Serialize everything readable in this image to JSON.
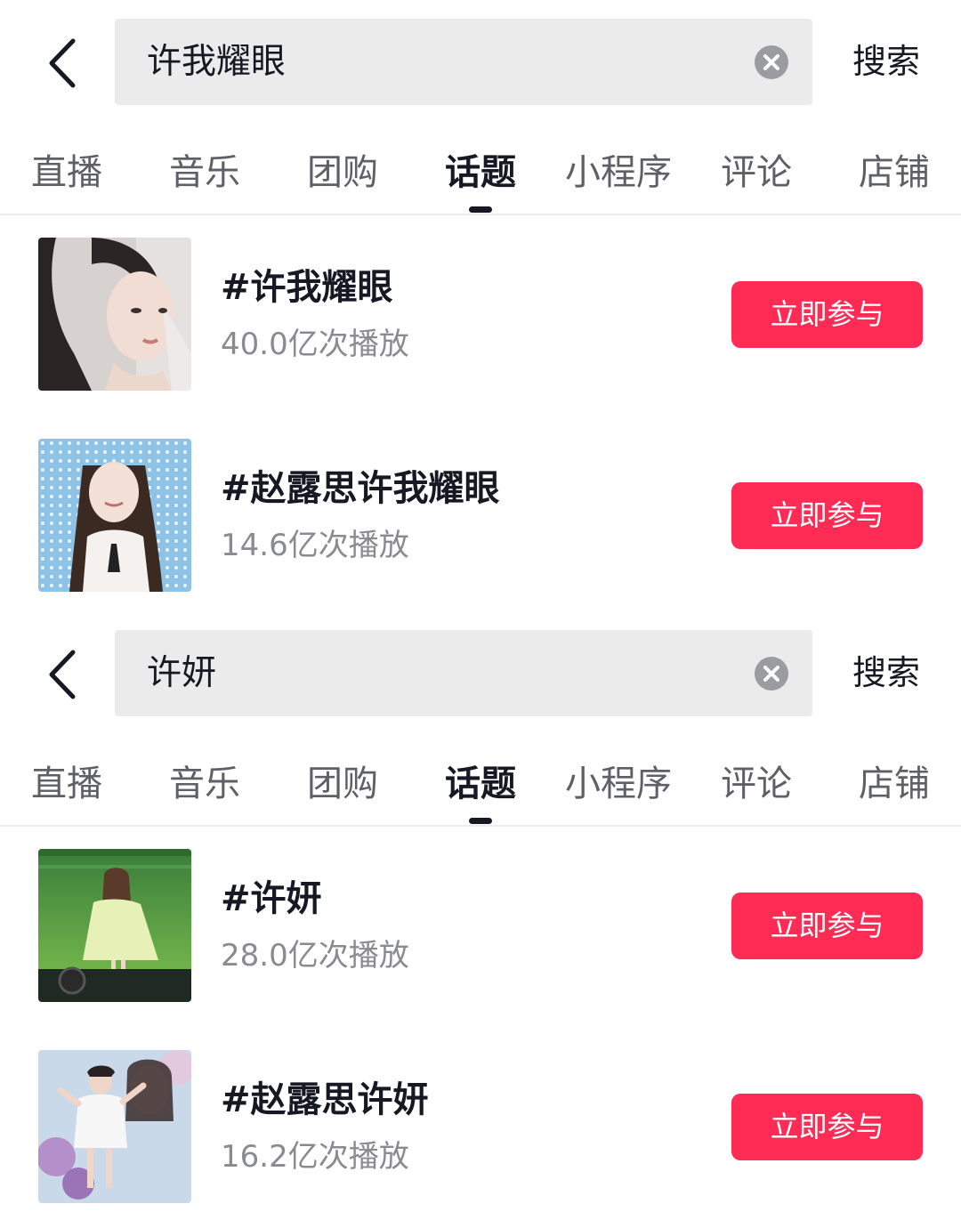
{
  "screens": [
    {
      "query": "许我耀眼",
      "search_label": "搜索",
      "tabs": [
        "直播",
        "音乐",
        "团购",
        "话题",
        "小程序",
        "评论",
        "店铺"
      ],
      "active_tab": "话题",
      "topics": [
        {
          "title": "#许我耀眼",
          "stats": "40.0亿次播放",
          "button": "立即参与",
          "thumb": "portrait-hands-in-hair"
        },
        {
          "title": "#赵露思许我耀眼",
          "stats": "14.6亿次播放",
          "button": "立即参与",
          "thumb": "portrait-stage-lights"
        }
      ]
    },
    {
      "query": "许妍",
      "search_label": "搜索",
      "tabs": [
        "直播",
        "音乐",
        "团购",
        "话题",
        "小程序",
        "评论",
        "店铺"
      ],
      "active_tab": "话题",
      "topics": [
        {
          "title": "#许妍",
          "stats": "28.0亿次播放",
          "button": "立即参与",
          "thumb": "singer-on-green-stage"
        },
        {
          "title": "#赵露思许妍",
          "stats": "16.2亿次播放",
          "button": "立即参与",
          "thumb": "poster-with-flowers"
        }
      ]
    }
  ],
  "colors": {
    "accent": "#fe2c55",
    "text_primary": "#161823",
    "text_secondary": "#8a8b91",
    "search_bg": "#ebebec"
  }
}
